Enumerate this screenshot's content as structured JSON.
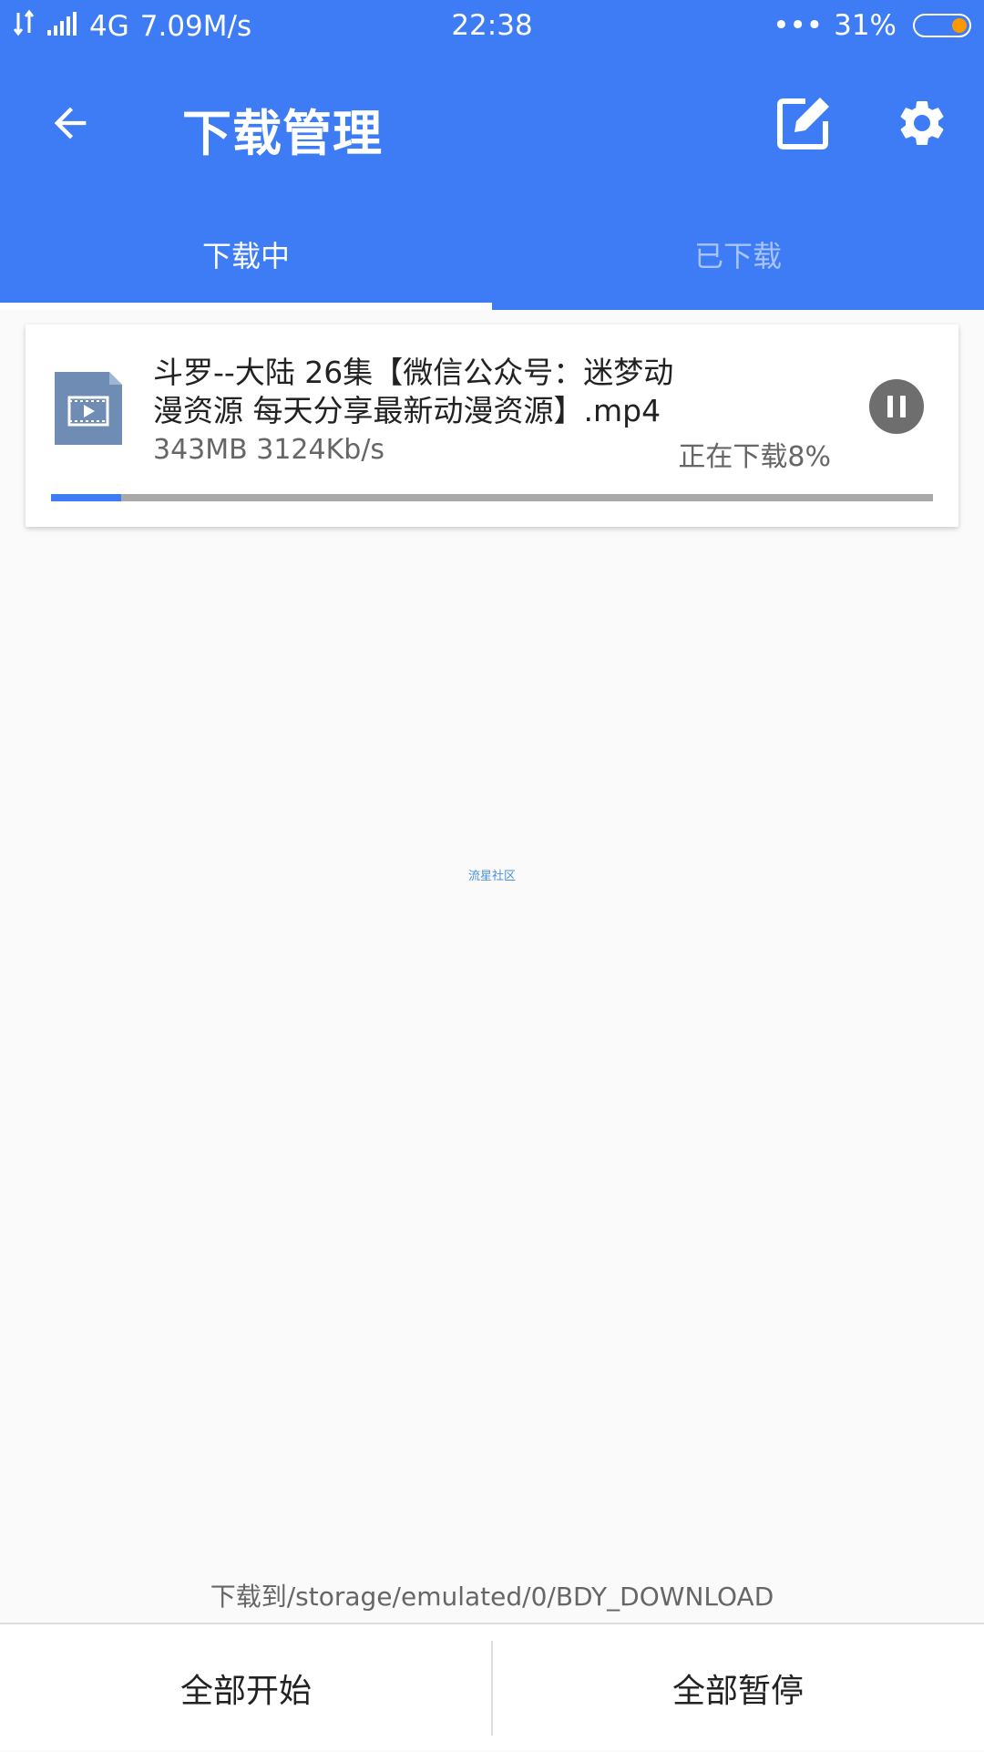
{
  "statusbar": {
    "network": "4G",
    "speed": "7.09M/s",
    "time": "22:38",
    "dots": "•••",
    "battery_percent": "31%",
    "battery_level": 0.31,
    "icons": [
      "data-arrows-icon",
      "signal-icon",
      "battery-icon"
    ]
  },
  "toolbar": {
    "title": "下载管理",
    "back_icon": "arrow-back-icon",
    "edit_icon": "edit-icon",
    "settings_icon": "gear-icon"
  },
  "tabs": [
    {
      "label": "下载中",
      "active": true
    },
    {
      "label": "已下载",
      "active": false
    }
  ],
  "downloads": [
    {
      "file_name": "斗罗--大陆 26集【微信公众号：迷梦动漫资源 每天分享最新动漫资源】.mp4",
      "size_speed": "343MB 3124Kb/s",
      "status": "正在下载8%",
      "progress": 0.08,
      "file_icon": "video-file-icon",
      "action_icon": "pause-icon"
    }
  ],
  "watermark": "流星社区",
  "save_path": "下载到/storage/emulated/0/BDY_DOWNLOAD",
  "bottom": {
    "start_all": "全部开始",
    "pause_all": "全部暂停"
  },
  "colors": {
    "primary": "#3d7cf5",
    "battery_accent": "#ff9800",
    "pause_button": "#6e6e6e",
    "file_icon": "#6f8db4"
  }
}
